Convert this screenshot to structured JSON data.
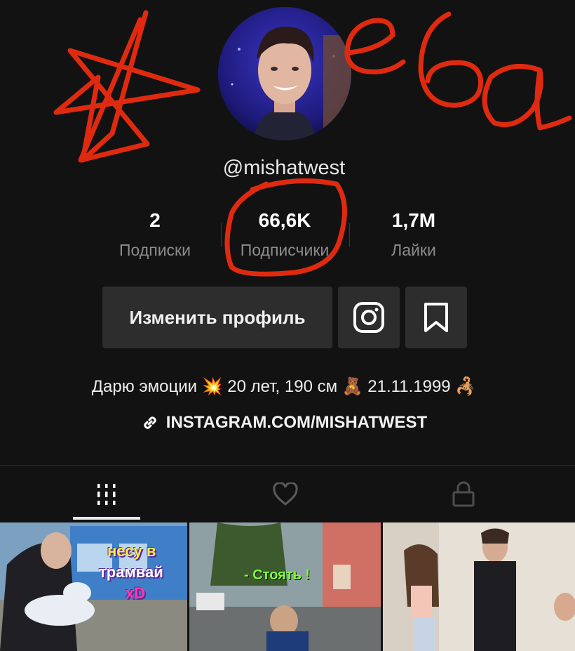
{
  "profile": {
    "username": "@mishatwest",
    "avatar_icon": "user-avatar"
  },
  "stats": [
    {
      "value": "2",
      "label": "Подписки"
    },
    {
      "value": "66,6K",
      "label": "Подписчики"
    },
    {
      "value": "1,7M",
      "label": "Лайки"
    }
  ],
  "actions": {
    "edit_profile_label": "Изменить профиль",
    "instagram_icon": "instagram-icon",
    "bookmark_icon": "bookmark-icon"
  },
  "bio": {
    "text": "Дарю эмоции 💥 20 лет, 190 см 🧸 21.11.1999 🦂",
    "link_icon": "link-icon",
    "link_text": "INSTAGRAM.COM/MISHATWEST"
  },
  "tabs": [
    {
      "icon": "grid-icon",
      "active": true
    },
    {
      "icon": "heart-icon",
      "active": false
    },
    {
      "icon": "lock-icon",
      "active": false
    }
  ],
  "videos": [
    {
      "caption_lines": [
        "несу в",
        "трамвай",
        "xD"
      ]
    },
    {
      "caption_lines": [
        "- Стоять !"
      ]
    },
    {
      "caption_lines": []
    }
  ],
  "annotations": {
    "scribble_text": "еба",
    "color": "#e02a10"
  },
  "colors": {
    "background": "#121212",
    "button": "#2d2d2d",
    "muted_text": "#8c8c8c"
  }
}
